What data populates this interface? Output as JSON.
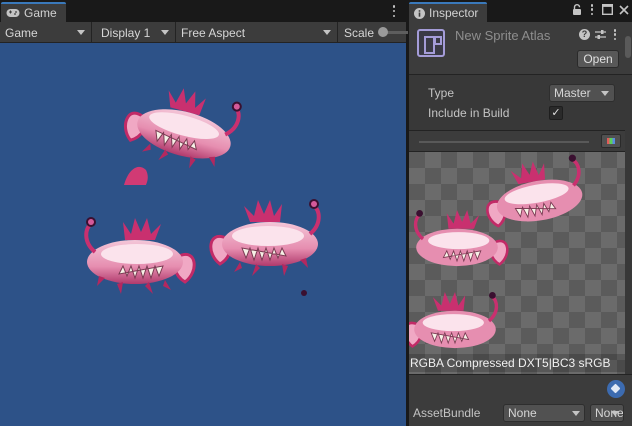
{
  "game": {
    "tab_title": "Game",
    "tab_icon": "gamepad-icon",
    "view_dropdown": "Game",
    "display_dropdown": "Display 1",
    "aspect_dropdown": "Free Aspect",
    "scale_label": "Scale",
    "background_color": "#2d5288"
  },
  "inspector": {
    "tab_title": "Inspector",
    "tab_icon": "info-icon",
    "asset_title": "New Sprite Atlas",
    "asset_icon": "sprite-atlas-icon",
    "open_button": "Open",
    "properties": [
      {
        "label": "Type",
        "value": "Master",
        "kind": "dropdown"
      },
      {
        "label": "Include in Build",
        "value": "✓",
        "kind": "checkbox"
      }
    ],
    "preview_info": "RGBA Compressed DXT5|BC3 sRGB",
    "asset_bundle": {
      "label": "AssetBundle",
      "name": "None",
      "variant": "None"
    },
    "accent_color": "#a49cd8"
  }
}
